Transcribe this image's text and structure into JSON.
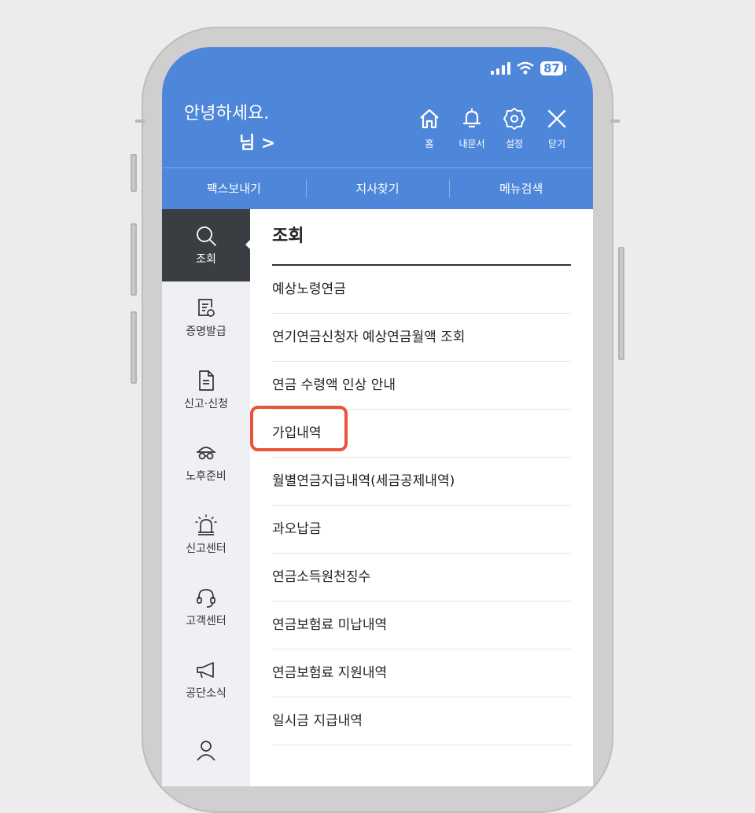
{
  "status_bar": {
    "battery": "87"
  },
  "header": {
    "greeting": "안녕하세요.",
    "user_suffix": "님 >",
    "actions": [
      {
        "label": "홈",
        "icon": "home-icon"
      },
      {
        "label": "내문서",
        "icon": "bell-icon"
      },
      {
        "label": "설정",
        "icon": "gear-icon"
      },
      {
        "label": "닫기",
        "icon": "close-icon"
      }
    ]
  },
  "subnav": [
    "팩스보내기",
    "지사찾기",
    "메뉴검색"
  ],
  "sidebar": {
    "items": [
      {
        "label": "조회",
        "icon": "search-icon",
        "active": true
      },
      {
        "label": "증명발급",
        "icon": "certificate-icon"
      },
      {
        "label": "신고·신청",
        "icon": "document-icon"
      },
      {
        "label": "노후준비",
        "icon": "elderly-icon"
      },
      {
        "label": "신고센터",
        "icon": "siren-icon"
      },
      {
        "label": "고객센터",
        "icon": "headset-icon"
      },
      {
        "label": "공단소식",
        "icon": "megaphone-icon"
      },
      {
        "label": "",
        "icon": "user-icon"
      }
    ]
  },
  "main": {
    "section_title": "조회",
    "menu_items": [
      "예상노령연금",
      "연기연금신청자 예상연금월액 조회",
      "연금 수령액 인상 안내",
      "가입내역",
      "월별연금지급내역(세금공제내역)",
      "과오납금",
      "연금소득원천징수",
      "연금보험료 미납내역",
      "연금보험료 지원내역",
      "일시금 지급내역"
    ],
    "highlighted_item": "가입내역"
  },
  "colors": {
    "header": "#4e86d9",
    "rail_active": "#3a3d42",
    "highlight": "#e8533a"
  }
}
